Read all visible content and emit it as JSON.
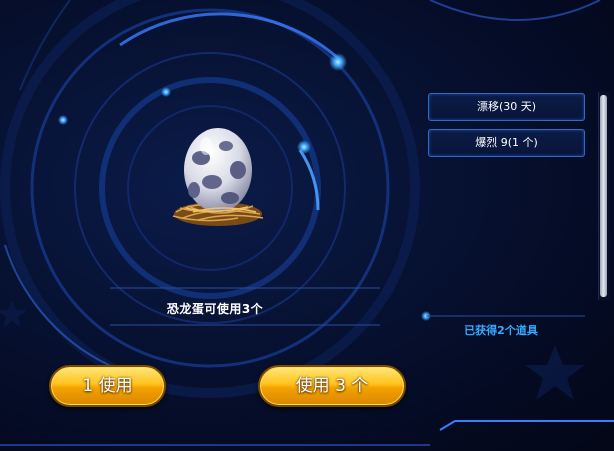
{
  "reward": {
    "caption": "恐龙蛋可使用3个",
    "item_icon": "dinosaur-egg-in-nest-icon"
  },
  "buttons": {
    "use_one": "1 使用",
    "use_all": "使用 3 个"
  },
  "item_list": [
    {
      "label": "漂移(30 天)"
    },
    {
      "label": "爆烈 9(1 个)"
    }
  ],
  "obtained_text": "已获得2个道具",
  "colors": {
    "background": "#05081c",
    "button_gold": "#ffc21d",
    "accent_blue": "#36a8ff",
    "item_border": "#2f6bc6"
  }
}
